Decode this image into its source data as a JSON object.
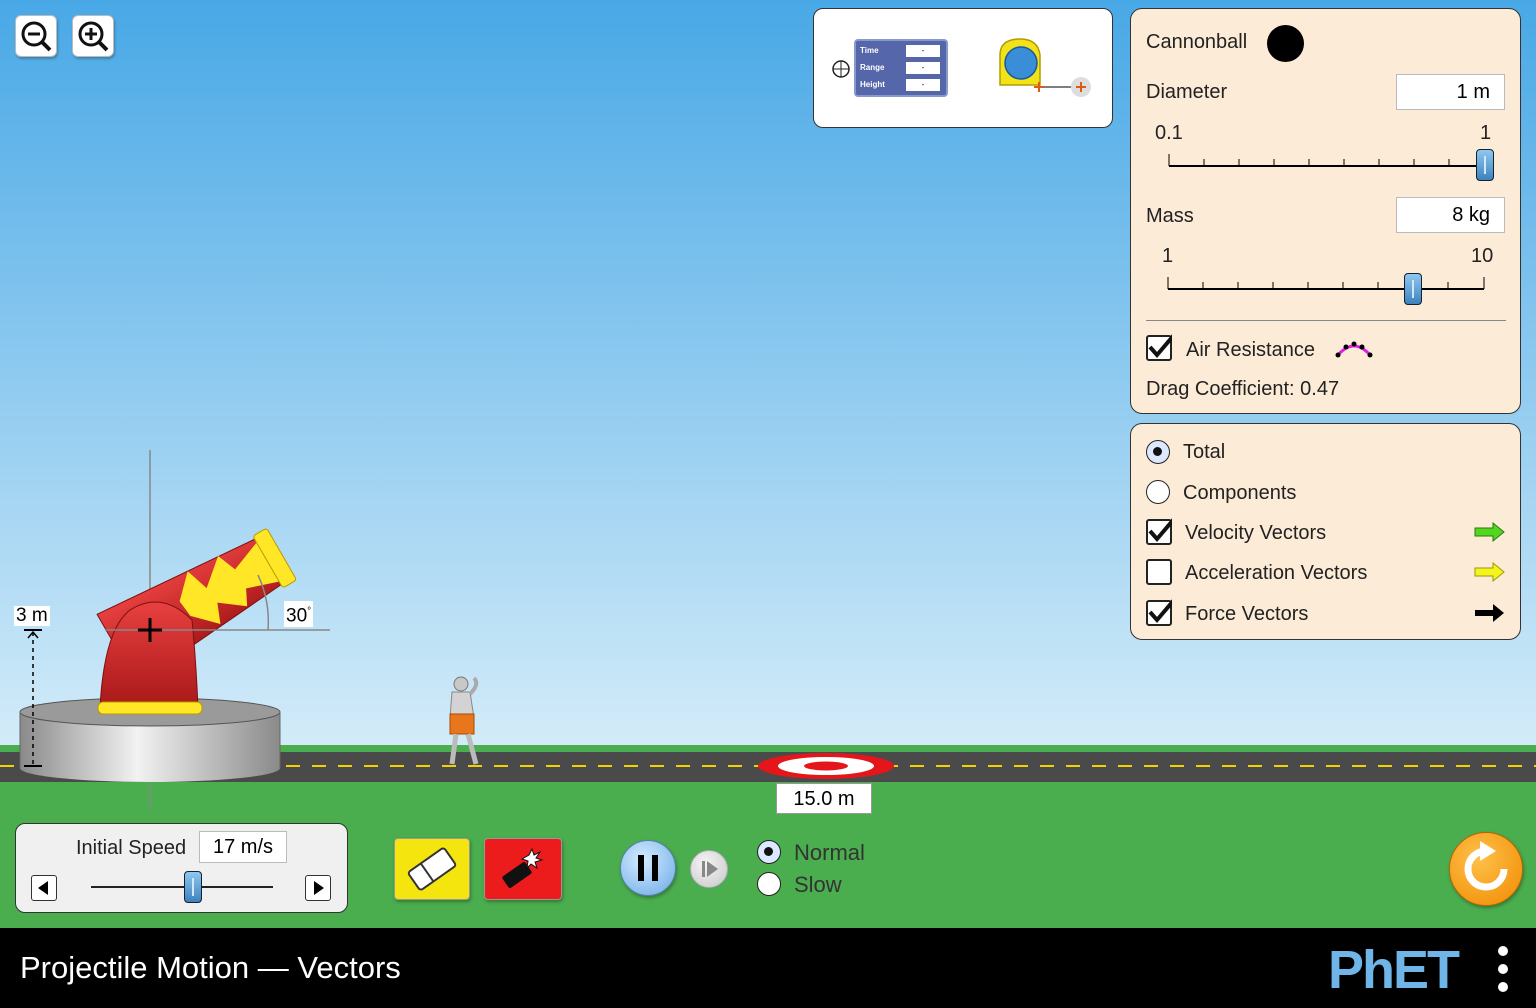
{
  "app": {
    "title": "Projectile Motion — Vectors",
    "logo": "PhET"
  },
  "colors": {
    "sky_top": "#4aa9e6",
    "sky_bottom": "#cfe9f8",
    "grass": "#4aad4e",
    "panel_bg": "#fcebd7",
    "cannon_red": "#d42a2a",
    "flame_yellow": "#ffe626"
  },
  "toolbar": {
    "zoom_out_icon": "zoom-out-icon",
    "zoom_in_icon": "zoom-in-icon"
  },
  "toolbox": {
    "time_label": "Time",
    "range_label": "Range",
    "height_label": "Height",
    "time_value": "-",
    "range_value": "-",
    "height_value": "-"
  },
  "cannon": {
    "height_label": "3 m",
    "angle_label": "30",
    "angle_unit": "°"
  },
  "target": {
    "distance_label": "15.0 m"
  },
  "projectile_panel": {
    "title": "Cannonball",
    "diameter_label": "Diameter",
    "diameter_value": "1 m",
    "diameter_min": "0.1",
    "diameter_max": "1",
    "diameter_fraction": 1.0,
    "mass_label": "Mass",
    "mass_value": "8 kg",
    "mass_min": "1",
    "mass_max": "10",
    "mass_fraction": 0.778,
    "air_resistance_label": "Air Resistance",
    "air_resistance_checked": true,
    "drag_coefficient_text": "Drag Coefficient: 0.47"
  },
  "vectors_panel": {
    "total_label": "Total",
    "total_selected": true,
    "components_label": "Components",
    "components_selected": false,
    "velocity_label": "Velocity Vectors",
    "velocity_checked": true,
    "velocity_color": "#52d61e",
    "acceleration_label": "Acceleration Vectors",
    "acceleration_checked": false,
    "acceleration_color": "#f5f51d",
    "force_label": "Force Vectors",
    "force_checked": true,
    "force_color": "#000000"
  },
  "speed_control": {
    "label": "Initial Speed",
    "value": "17 m/s",
    "fraction": 0.567
  },
  "playback": {
    "normal_label": "Normal",
    "slow_label": "Slow",
    "speed_selected": "Normal",
    "state": "playing"
  }
}
